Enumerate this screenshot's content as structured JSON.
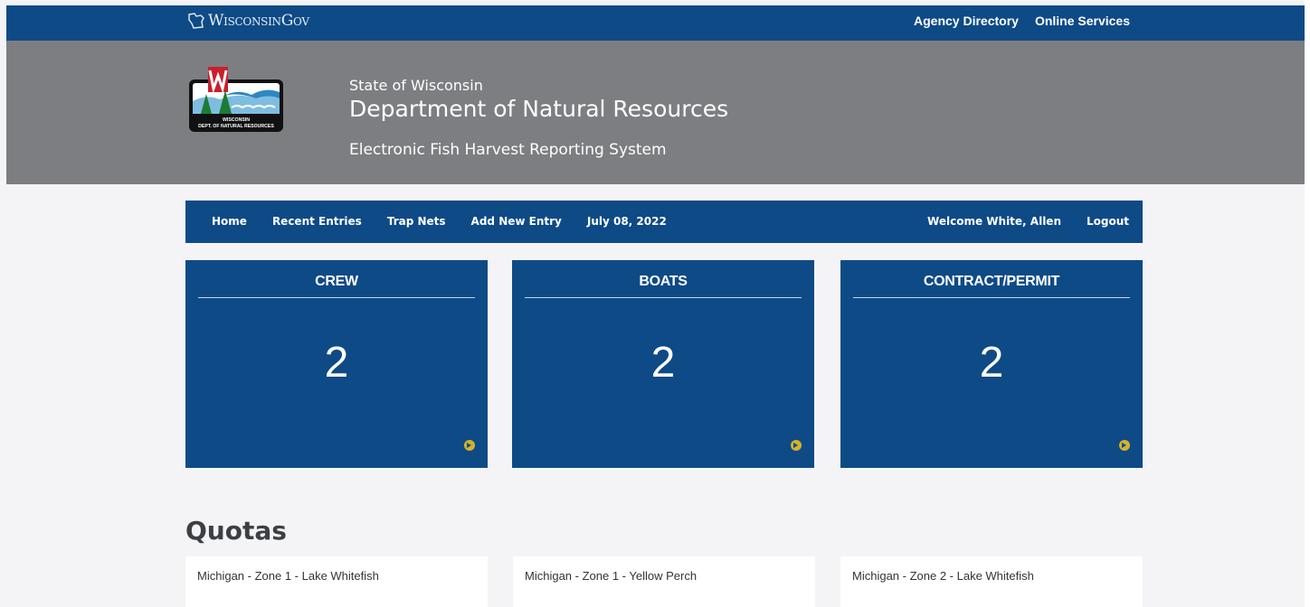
{
  "gov_bar": {
    "logo_text": "WisconsinGov",
    "links": [
      "Agency Directory",
      "Online Services"
    ]
  },
  "header": {
    "logo_alt": "Wisconsin Dept. of Natural Resources",
    "state": "State of Wisconsin",
    "department": "Department of Natural Resources",
    "system": "Electronic Fish Harvest Reporting System"
  },
  "nav": {
    "home": "Home",
    "recent_entries": "Recent Entries",
    "trap_nets": "Trap Nets",
    "add_new_entry": "Add New Entry",
    "date": "July 08, 2022",
    "welcome": "Welcome White, Allen",
    "logout": "Logout"
  },
  "cards": [
    {
      "title": "CREW",
      "value": "2"
    },
    {
      "title": "BOATS",
      "value": "2"
    },
    {
      "title": "CONTRACT/PERMIT",
      "value": "2"
    }
  ],
  "quotas": {
    "heading": "Quotas",
    "items": [
      {
        "title": "Michigan - Zone 1 - Lake Whitefish"
      },
      {
        "title": "Michigan - Zone 1 - Yellow Perch"
      },
      {
        "title": "Michigan - Zone 2 - Lake Whitefish"
      }
    ]
  },
  "colors": {
    "primary_blue": "#0e4a86",
    "header_gray": "#7d7e82",
    "accent_gold": "#d4b22a",
    "page_bg": "#f4f4f6"
  }
}
